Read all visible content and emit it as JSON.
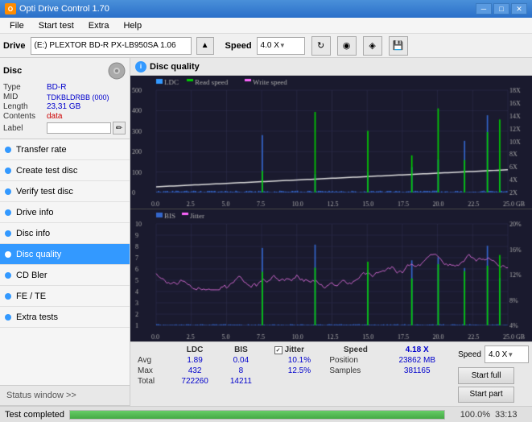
{
  "app": {
    "title": "Opti Drive Control 1.70",
    "title_icon": "O"
  },
  "title_bar": {
    "minimize_label": "─",
    "maximize_label": "□",
    "close_label": "✕"
  },
  "menu": {
    "items": [
      "File",
      "Start test",
      "Extra",
      "Help"
    ]
  },
  "drive_bar": {
    "drive_label": "Drive",
    "drive_value": "(E:)  PLEXTOR BD-R  PX-LB950SA 1.06",
    "eject_icon": "▲",
    "speed_label": "Speed",
    "speed_value": "4.0 X"
  },
  "disc_panel": {
    "title": "Disc",
    "type_label": "Type",
    "type_value": "BD-R",
    "mid_label": "MID",
    "mid_value": "TDKBLDRBB (000)",
    "length_label": "Length",
    "length_value": "23,31 GB",
    "contents_label": "Contents",
    "contents_value": "data",
    "label_label": "Label",
    "label_value": ""
  },
  "nav": {
    "items": [
      {
        "id": "transfer-rate",
        "label": "Transfer rate",
        "active": false
      },
      {
        "id": "create-test-disc",
        "label": "Create test disc",
        "active": false
      },
      {
        "id": "verify-test-disc",
        "label": "Verify test disc",
        "active": false
      },
      {
        "id": "drive-info",
        "label": "Drive info",
        "active": false
      },
      {
        "id": "disc-info",
        "label": "Disc info",
        "active": false
      },
      {
        "id": "disc-quality",
        "label": "Disc quality",
        "active": true
      },
      {
        "id": "cd-bler",
        "label": "CD Bler",
        "active": false
      },
      {
        "id": "fe-te",
        "label": "FE / TE",
        "active": false
      },
      {
        "id": "extra-tests",
        "label": "Extra tests",
        "active": false
      }
    ],
    "status_btn": "Status window >>"
  },
  "disc_quality": {
    "title": "Disc quality",
    "legend": {
      "ldc": "LDC",
      "read_speed": "Read speed",
      "write_speed": "Write speed",
      "bis": "BIS",
      "jitter": "Jitter"
    }
  },
  "stats": {
    "columns": [
      "LDC",
      "BIS",
      "",
      "Jitter",
      "Speed",
      "4.18 X"
    ],
    "speed_select": "4.0 X",
    "rows": [
      {
        "label": "Avg",
        "ldc": "1.89",
        "bis": "0.04",
        "jitter": "10.1%"
      },
      {
        "label": "Max",
        "ldc": "432",
        "bis": "8",
        "jitter": "12.5%"
      },
      {
        "label": "Total",
        "ldc": "722260",
        "bis": "14211",
        "jitter": ""
      }
    ],
    "position_label": "Position",
    "position_value": "23862 MB",
    "samples_label": "Samples",
    "samples_value": "381165",
    "start_full_label": "Start full",
    "start_part_label": "Start part"
  },
  "progress": {
    "percent": 100.0,
    "percent_text": "100.0%",
    "time": "33:13",
    "status_text": "Test completed"
  },
  "chart_top": {
    "y_axis_left": [
      500,
      400,
      300,
      200,
      100,
      0
    ],
    "y_axis_right": [
      "18X",
      "16X",
      "14X",
      "12X",
      "10X",
      "8X",
      "6X",
      "4X",
      "2X"
    ],
    "x_axis": [
      "0.0",
      "2.5",
      "5.0",
      "7.5",
      "10.0",
      "12.5",
      "15.0",
      "17.5",
      "20.0",
      "22.5",
      "25.0 GB"
    ]
  },
  "chart_bottom": {
    "y_axis_left": [
      10,
      9,
      8,
      7,
      6,
      5,
      4,
      3,
      2,
      1
    ],
    "y_axis_right": [
      "20%",
      "16%",
      "12%",
      "8%",
      "4%"
    ],
    "x_axis": [
      "0.0",
      "2.5",
      "5.0",
      "7.5",
      "10.0",
      "12.5",
      "15.0",
      "17.5",
      "20.0",
      "22.5",
      "25.0 GB"
    ]
  }
}
